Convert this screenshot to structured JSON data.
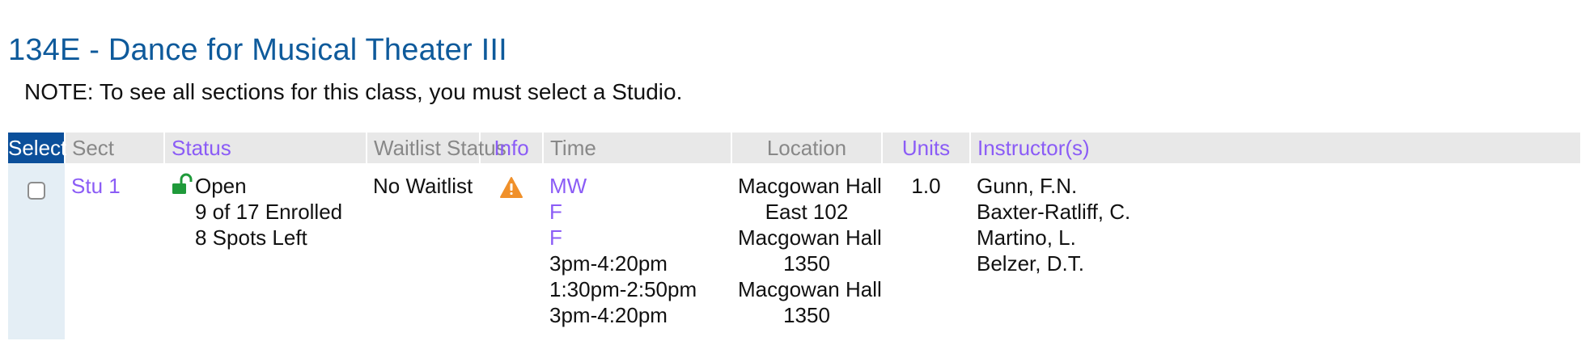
{
  "course": {
    "title": "134E - Dance for Musical Theater III",
    "note": "NOTE: To see all sections for this class, you must select a Studio."
  },
  "table": {
    "headers": {
      "select": "Select",
      "sect": "Sect",
      "status": "Status",
      "waitlist": "Waitlist Status",
      "info": "Info",
      "time": "Time",
      "location": "Location",
      "units": "Units",
      "instructors": "Instructor(s)"
    },
    "rows": [
      {
        "section": "Stu 1",
        "status": "Open",
        "enrolled": "9 of 17 Enrolled",
        "spots_left": "8 Spots Left",
        "waitlist": "No Waitlist",
        "info_icon": "warning-icon",
        "days": [
          "MW",
          "F",
          "F"
        ],
        "times": [
          "3pm-4:20pm",
          "1:30pm-2:50pm",
          "3pm-4:20pm"
        ],
        "locations": [
          "Macgowan Hall",
          "East 102",
          "Macgowan Hall",
          "1350",
          "Macgowan Hall",
          "1350"
        ],
        "units": "1.0",
        "instructors": [
          "Gunn, F.N.",
          "Baxter-Ratliff, C.",
          "Martino, L.",
          "Belzer, D.T."
        ]
      }
    ]
  },
  "colors": {
    "title": "#0e5a9b",
    "select_header": "#0b4f9a",
    "link": "#8b5cf6",
    "lock": "#1f9a3a",
    "warning": "#f0902a"
  }
}
